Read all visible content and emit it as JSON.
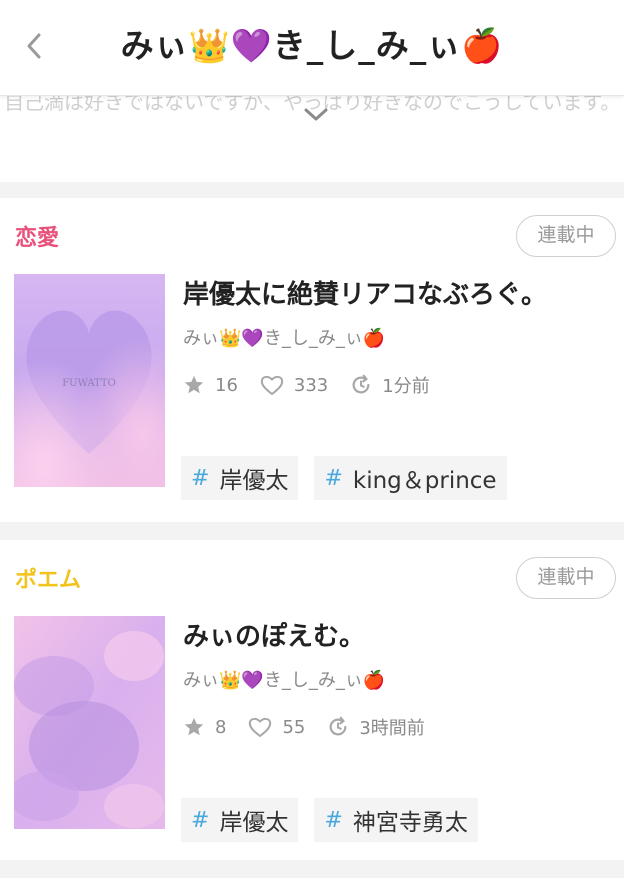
{
  "header": {
    "title": "みぃ👑💜き_し_み_ぃ🍎"
  },
  "description": {
    "text": "自己満は好きではないですが、やっぱり好きなのでこうしています。"
  },
  "stories": [
    {
      "genre": "恋愛",
      "genre_color": "#e8527a",
      "status": "連載中",
      "title": "岸優太に絶賛リアコなぶろぐ。",
      "author": "みぃ👑💜き_し_み_ぃ🍎",
      "stars": "16",
      "likes": "333",
      "updated": "1分前",
      "cover_text": "FUWATTO",
      "tags": [
        "岸優太",
        "king＆prince"
      ]
    },
    {
      "genre": "ポエム",
      "genre_color": "#f2c31a",
      "status": "連載中",
      "title": "みぃのぽえむ。",
      "author": "みぃ👑💜き_し_み_ぃ🍎",
      "stars": "8",
      "likes": "55",
      "updated": "3時間前",
      "tags": [
        "岸優太",
        "神宮寺勇太"
      ]
    }
  ],
  "tag_symbol": "#"
}
